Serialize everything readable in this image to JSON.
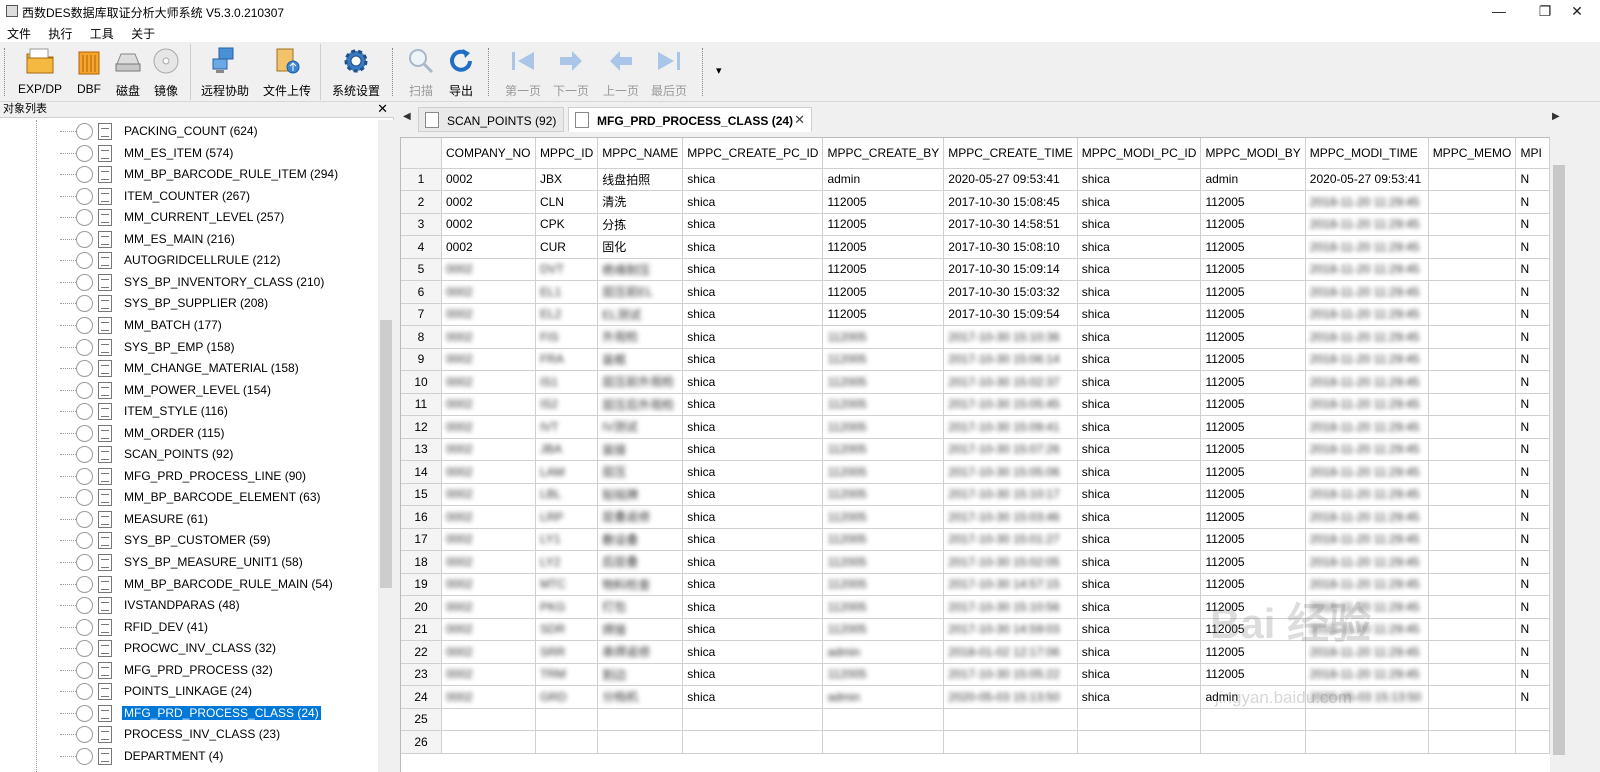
{
  "window": {
    "title": "西数DES数据库取证分析大师系统 V5.3.0.210307",
    "minimize": "—",
    "maximize": "❐",
    "close": "✕"
  },
  "menu": [
    "文件",
    "执行",
    "工具",
    "关于"
  ],
  "toolbar": {
    "groups": [
      [
        {
          "label": "EXP/DP",
          "icon": "folder-icon",
          "disabled": false
        },
        {
          "label": "DBF",
          "icon": "dbf-bars-icon",
          "disabled": false
        },
        {
          "label": "磁盘",
          "icon": "disk-icon",
          "disabled": false
        },
        {
          "label": "镜像",
          "icon": "disc-image-icon",
          "disabled": false
        }
      ],
      [
        {
          "label": "远程协助",
          "icon": "remote-pc-icon",
          "disabled": false
        },
        {
          "label": "文件上传",
          "icon": "file-upload-icon",
          "disabled": false
        },
        {
          "label": "系统设置",
          "icon": "gear-icon",
          "disabled": false
        }
      ],
      [
        {
          "label": "扫描",
          "icon": "magnifier-icon",
          "disabled": true
        },
        {
          "label": "导出",
          "icon": "refresh-export-icon",
          "disabled": false
        }
      ],
      [
        {
          "label": "第一页",
          "icon": "first-page-icon",
          "disabled": true
        },
        {
          "label": "下一页",
          "icon": "next-page-icon",
          "disabled": true
        },
        {
          "label": "上一页",
          "icon": "prev-page-icon",
          "disabled": true
        },
        {
          "label": "最后页",
          "icon": "last-page-icon",
          "disabled": true
        }
      ]
    ],
    "overflow": "▾"
  },
  "object_panel": {
    "title": "对象列表",
    "close": "✕",
    "items": [
      "PACKING_COUNT (624)",
      "MM_ES_ITEM (574)",
      "MM_BP_BARCODE_RULE_ITEM (294)",
      "ITEM_COUNTER (267)",
      "MM_CURRENT_LEVEL (257)",
      "MM_ES_MAIN (216)",
      "AUTOGRIDCELLRULE (212)",
      "SYS_BP_INVENTORY_CLASS (210)",
      "SYS_BP_SUPPLIER (208)",
      "MM_BATCH (177)",
      "SYS_BP_EMP (158)",
      "MM_CHANGE_MATERIAL (158)",
      "MM_POWER_LEVEL (154)",
      "ITEM_STYLE (116)",
      "MM_ORDER (115)",
      "SCAN_POINTS (92)",
      "MFG_PRD_PROCESS_LINE (90)",
      "MM_BP_BARCODE_ELEMENT (63)",
      "MEASURE (61)",
      "SYS_BP_CUSTOMER (59)",
      "SYS_BP_MEASURE_UNIT1 (58)",
      "MM_BP_BARCODE_RULE_MAIN (54)",
      "IVSTANDPARAS (48)",
      "RFID_DEV (41)",
      "PROCWC_INV_CLASS (32)",
      "MFG_PRD_PROCESS (32)",
      "POINTS_LINKAGE (24)",
      "MFG_PRD_PROCESS_CLASS (24)",
      "PROCESS_INV_CLASS (23)",
      "DEPARTMENT (4)"
    ],
    "selected_index": 27
  },
  "tabs": {
    "left_arrow": "◀",
    "right_arrow": "▶",
    "items": [
      {
        "label": "SCAN_POINTS (92)",
        "active": false
      },
      {
        "label": "MFG_PRD_PROCESS_CLASS (24)",
        "active": true,
        "close": "✕"
      }
    ]
  },
  "grid": {
    "columns": [
      "COMPANY_NO",
      "MPPC_ID",
      "MPPC_NAME",
      "MPPC_CREATE_PC_ID",
      "MPPC_CREATE_BY",
      "MPPC_CREATE_TIME",
      "MPPC_MODI_PC_ID",
      "MPPC_MODI_BY",
      "MPPC_MODI_TIME",
      "MPPC_MEMO",
      "MPI"
    ],
    "rows": [
      [
        "1",
        "0002",
        "JBX",
        "线盘拍照",
        "shica",
        "admin",
        "2020-05-27 09:53:41",
        "shica",
        "admin",
        "2020-05-27 09:53:41",
        "",
        "N"
      ],
      [
        "2",
        "0002",
        "CLN",
        "清洗",
        "shica",
        "112005",
        "2017-10-30 15:08:45",
        "shica",
        "112005",
        "2018-11-20 11:29:45",
        "",
        "N"
      ],
      [
        "3",
        "0002",
        "CPK",
        "分拣",
        "shica",
        "112005",
        "2017-10-30 14:58:51",
        "shica",
        "112005",
        "2018-11-20 11:29:45",
        "",
        "N"
      ],
      [
        "4",
        "0002",
        "CUR",
        "固化",
        "shica",
        "112005",
        "2017-10-30 15:08:10",
        "shica",
        "112005",
        "2018-11-20 11:29:45",
        "",
        "N"
      ],
      [
        "5",
        "0002",
        "DVT",
        "绝缘耐压",
        "shica",
        "112005",
        "2017-10-30 15:09:14",
        "shica",
        "112005",
        "2018-11-20 11:29:45",
        "",
        "N"
      ],
      [
        "6",
        "0002",
        "EL1",
        "层压前EL",
        "shica",
        "112005",
        "2017-10-30 15:03:32",
        "shica",
        "112005",
        "2018-11-20 11:29:45",
        "",
        "N"
      ],
      [
        "7",
        "0002",
        "EL2",
        "EL测试",
        "shica",
        "112005",
        "2017-10-30 15:09:54",
        "shica",
        "112005",
        "2018-11-20 11:29:45",
        "",
        "N"
      ],
      [
        "8",
        "0002",
        "FIS",
        "外观检",
        "shica",
        "112005",
        "2017-10-30 15:10:36",
        "shica",
        "112005",
        "2018-11-20 11:29:45",
        "",
        "N"
      ],
      [
        "9",
        "0002",
        "FRA",
        "装框",
        "shica",
        "112005",
        "2017-10-30 15:06:14",
        "shica",
        "112005",
        "2018-11-20 11:29:45",
        "",
        "N"
      ],
      [
        "10",
        "0002",
        "IS1",
        "层压前外观检",
        "shica",
        "112005",
        "2017-10-30 15:02:37",
        "shica",
        "112005",
        "2018-11-20 11:29:45",
        "",
        "N"
      ],
      [
        "11",
        "0002",
        "IS2",
        "层压后外观检",
        "shica",
        "112005",
        "2017-10-30 15:05:45",
        "shica",
        "112005",
        "2018-11-20 11:29:45",
        "",
        "N"
      ],
      [
        "12",
        "0002",
        "IVT",
        "IV测试",
        "shica",
        "112005",
        "2017-10-30 15:09:41",
        "shica",
        "112005",
        "2018-11-20 11:29:45",
        "",
        "N"
      ],
      [
        "13",
        "0002",
        "JBA",
        "装接",
        "shica",
        "112005",
        "2017-10-30 15:07:26",
        "shica",
        "112005",
        "2018-11-20 11:29:45",
        "",
        "N"
      ],
      [
        "14",
        "0002",
        "LAM",
        "层压",
        "shica",
        "112005",
        "2017-10-30 15:05:06",
        "shica",
        "112005",
        "2018-11-20 11:29:45",
        "",
        "N"
      ],
      [
        "15",
        "0002",
        "LBL",
        "贴铭牌",
        "shica",
        "112005",
        "2017-10-30 15:10:17",
        "shica",
        "112005",
        "2018-11-20 11:29:45",
        "",
        "N"
      ],
      [
        "16",
        "0002",
        "LRP",
        "层叠返修",
        "shica",
        "112005",
        "2017-10-30 15:03:46",
        "shica",
        "112005",
        "2018-11-20 11:29:45",
        "",
        "N"
      ],
      [
        "17",
        "0002",
        "LY1",
        "敷设叠",
        "shica",
        "112005",
        "2017-10-30 15:01:27",
        "shica",
        "112005",
        "2018-11-20 11:29:45",
        "",
        "N"
      ],
      [
        "18",
        "0002",
        "LY2",
        "后层叠",
        "shica",
        "112005",
        "2017-10-30 15:02:05",
        "shica",
        "112005",
        "2018-11-20 11:29:45",
        "",
        "N"
      ],
      [
        "19",
        "0002",
        "MTC",
        "物料检查",
        "shica",
        "112005",
        "2017-10-30 14:57:15",
        "shica",
        "112005",
        "2018-11-20 11:29:45",
        "",
        "N"
      ],
      [
        "20",
        "0002",
        "PKG",
        "打包",
        "shica",
        "112005",
        "2017-10-30 15:10:56",
        "shica",
        "112005",
        "2018-11-20 11:29:45",
        "",
        "N"
      ],
      [
        "21",
        "0002",
        "SDR",
        "焊接",
        "shica",
        "112005",
        "2017-10-30 14:59:03",
        "shica",
        "112005",
        "2018-11-20 11:29:45",
        "",
        "N"
      ],
      [
        "22",
        "0002",
        "SRR",
        "串焊返修",
        "shica",
        "admin",
        "2018-01-02 12:17:06",
        "shica",
        "112005",
        "2018-11-20 11:29:45",
        "",
        "N"
      ],
      [
        "23",
        "0002",
        "TRM",
        "割边",
        "shica",
        "112005",
        "2017-10-30 15:05:22",
        "shica",
        "112005",
        "2018-11-20 11:29:45",
        "",
        "N"
      ],
      [
        "24",
        "0002",
        "GRD",
        "分档机",
        "shica",
        "admin",
        "2020-05-03 15:13:50",
        "shica",
        "admin",
        "2020-05-03 15:13:50",
        "",
        "N"
      ],
      [
        "25",
        "",
        "",
        "",
        "",
        "",
        "",
        "",
        "",
        "",
        "",
        ""
      ],
      [
        "26",
        "",
        "",
        "",
        "",
        "",
        "",
        "",
        "",
        "",
        "",
        ""
      ]
    ]
  },
  "watermark": {
    "brand": "Bai 经验",
    "url": "jingyan.baidu.com"
  }
}
